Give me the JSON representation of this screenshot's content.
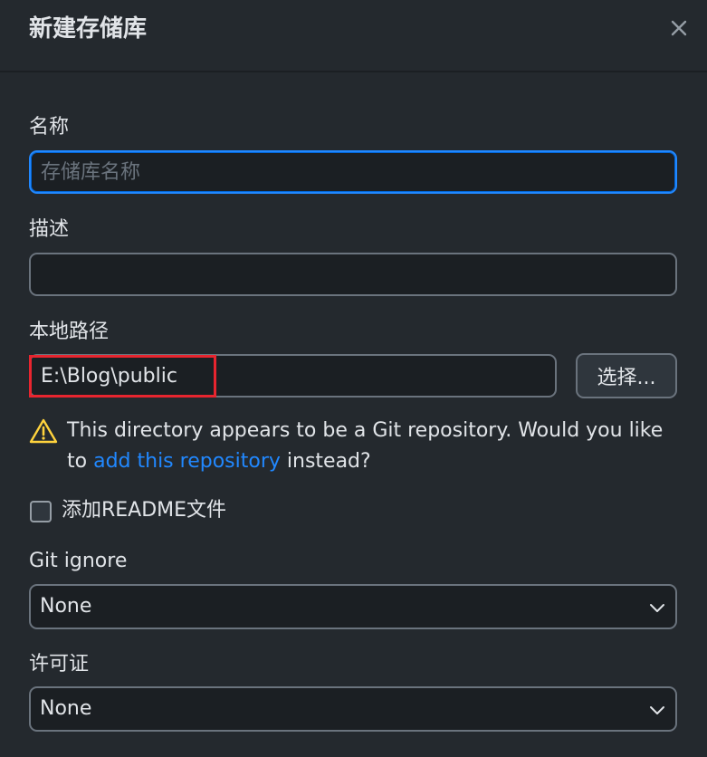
{
  "dialog": {
    "title": "新建存储库",
    "close_icon": "close-icon"
  },
  "name": {
    "label": "名称",
    "value": "",
    "placeholder": "存储库名称"
  },
  "description": {
    "label": "描述",
    "value": ""
  },
  "local_path": {
    "label": "本地路径",
    "value": "E:\\Blog\\public",
    "choose_label": "选择..."
  },
  "warning": {
    "icon": "warning-triangle-icon",
    "text_before": "This directory appears to be a Git repository. Would you like to ",
    "link_text": "add this repository",
    "text_after": " instead?"
  },
  "readme": {
    "label": "添加README文件",
    "checked": false
  },
  "gitignore": {
    "label": "Git ignore",
    "selected": "None"
  },
  "license": {
    "label": "许可证",
    "selected": "None"
  },
  "colors": {
    "background": "#24292e",
    "input_background": "#1b1f23",
    "focus_border": "#2188ff",
    "link": "#2188ff",
    "warning": "#ffd33d",
    "highlight_box": "#e8252f"
  }
}
